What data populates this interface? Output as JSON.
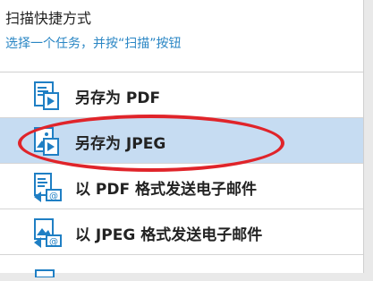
{
  "header": {
    "title": "扫描快捷方式",
    "subtitle": "选择一个任务，并按“扫描”按钮"
  },
  "tasks": [
    {
      "label": "另存为 PDF",
      "icon": "save-pdf-icon",
      "selected": false
    },
    {
      "label": "另存为 JPEG",
      "icon": "save-jpeg-icon",
      "selected": true
    },
    {
      "label": "以 PDF 格式发送电子邮件",
      "icon": "email-pdf-icon",
      "selected": false
    },
    {
      "label": "以 JPEG 格式发送电子邮件",
      "icon": "email-jpeg-icon",
      "selected": false
    }
  ],
  "colors": {
    "selected_row": "#c6dcf2",
    "subtitle": "#2a86c4",
    "annotation_ellipse": "#e0242a",
    "icon_blue": "#1f7fc4"
  }
}
